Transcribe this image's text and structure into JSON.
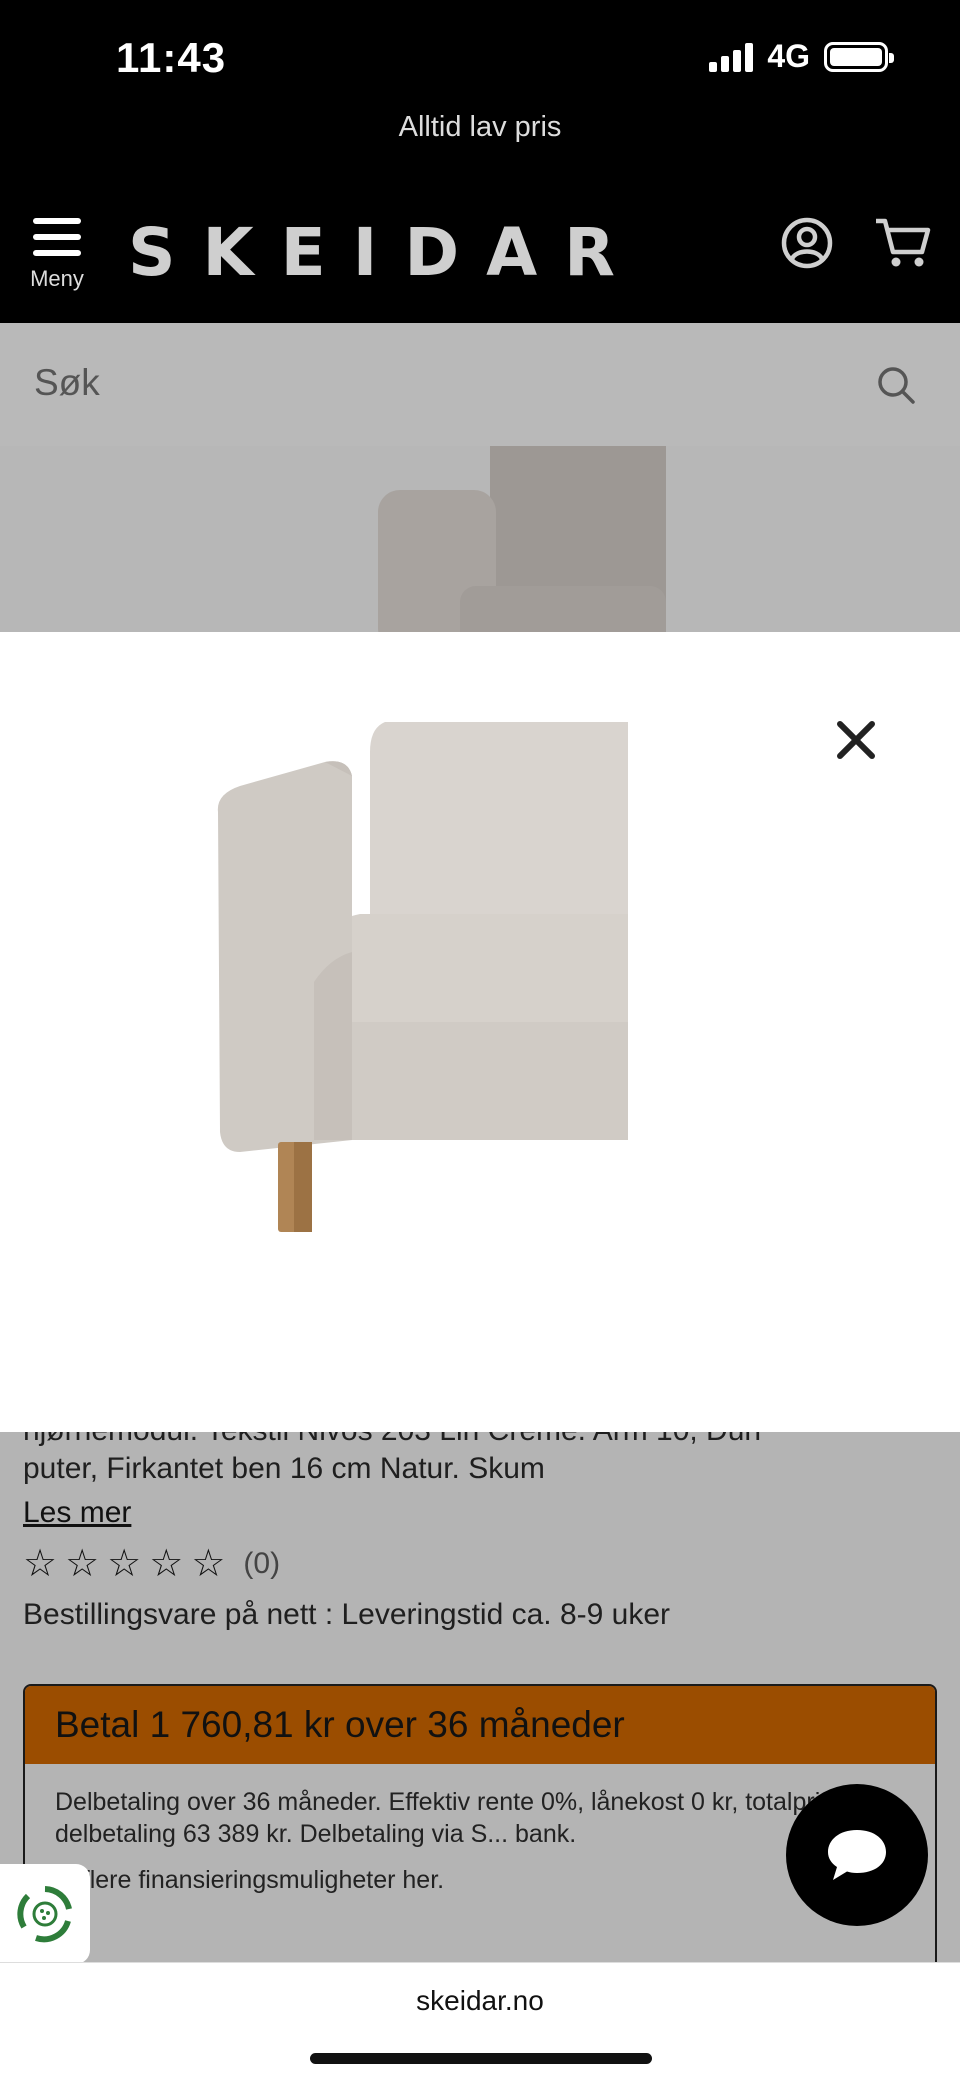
{
  "status_bar": {
    "time": "11:43",
    "network": "4G",
    "battery_level": 0.9
  },
  "promo": {
    "text": "Alltid lav pris"
  },
  "header": {
    "menu_label": "Meny",
    "logo_text": "SKEIDAR",
    "icons": [
      "account-icon",
      "cart-icon"
    ]
  },
  "search": {
    "placeholder": "Søk"
  },
  "modal": {
    "close_icon": "close-icon",
    "image_alt": "Armlene hjørnesofa Skum"
  },
  "product": {
    "description_cut": "hjørnemodul. Tekstil Nivos 203 Lin Creme. Arm 10, Dun",
    "description_line": "puter, Firkantet ben 16 cm Natur. Skum",
    "read_more": "Les mer",
    "rating_value": 0,
    "rating_max": 5,
    "rating_count": "(0)",
    "delivery": "Bestillingsvare på nett : Leveringstid ca. 8-9 uker"
  },
  "finance": {
    "headline": "Betal 1 760,81 kr over 36 måneder",
    "details": "Delbetaling over 36 måneder. Effektiv rente 0%, lånekost 0 kr, totalpris for delbetaling 63 389 kr. Delbetaling via S... bank.",
    "more_link": "... flere finansieringsmuligheter her.",
    "accent_color": "#9b4d00"
  },
  "chat": {
    "icon": "chat-bubble-icon"
  },
  "eco": {
    "icon": "recycle-badge-icon"
  },
  "browser": {
    "url": "skeidar.no"
  }
}
